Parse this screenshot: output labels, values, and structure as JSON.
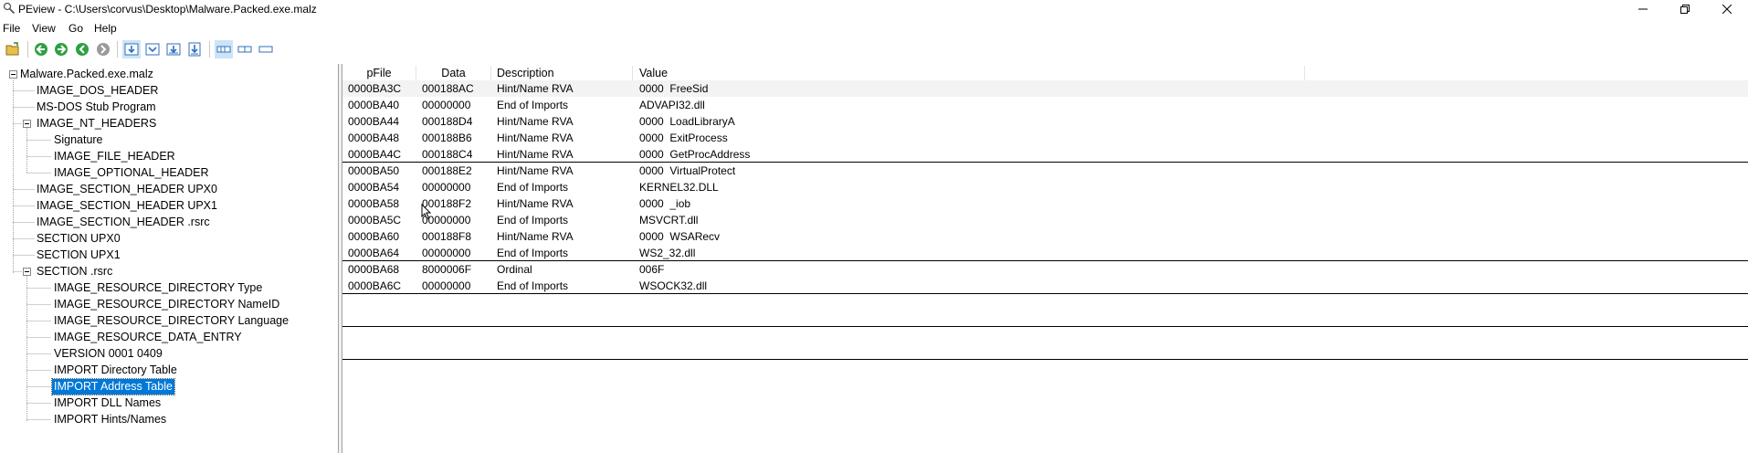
{
  "window": {
    "title": "PEview - C:\\Users\\corvus\\Desktop\\Malware.Packed.exe.malz"
  },
  "menu": [
    "File",
    "View",
    "Go",
    "Help"
  ],
  "toolbar": {
    "buttons": [
      "open-icon",
      "back-icon",
      "forward-icon",
      "previous-icon",
      "next-icon",
      "view-byte-icon",
      "view-word-icon",
      "view-dword-icon",
      "view-qword-icon",
      "hex-view-icon",
      "ascii-view-icon",
      "both-view-icon"
    ]
  },
  "tree": {
    "root": "Malware.Packed.exe.malz",
    "items": [
      {
        "label": "IMAGE_DOS_HEADER",
        "level": 1
      },
      {
        "label": "MS-DOS Stub Program",
        "level": 1
      },
      {
        "label": "IMAGE_NT_HEADERS",
        "level": 1
      },
      {
        "label": "Signature",
        "level": 2
      },
      {
        "label": "IMAGE_FILE_HEADER",
        "level": 2
      },
      {
        "label": "IMAGE_OPTIONAL_HEADER",
        "level": 2
      },
      {
        "label": "IMAGE_SECTION_HEADER UPX0",
        "level": 1
      },
      {
        "label": "IMAGE_SECTION_HEADER UPX1",
        "level": 1
      },
      {
        "label": "IMAGE_SECTION_HEADER .rsrc",
        "level": 1
      },
      {
        "label": "SECTION UPX0",
        "level": 1
      },
      {
        "label": "SECTION UPX1",
        "level": 1
      },
      {
        "label": "SECTION .rsrc",
        "level": 1
      },
      {
        "label": "IMAGE_RESOURCE_DIRECTORY Type",
        "level": 2
      },
      {
        "label": "IMAGE_RESOURCE_DIRECTORY NameID",
        "level": 2
      },
      {
        "label": "IMAGE_RESOURCE_DIRECTORY Language",
        "level": 2
      },
      {
        "label": "IMAGE_RESOURCE_DATA_ENTRY",
        "level": 2
      },
      {
        "label": "VERSION  0001  0409",
        "level": 2
      },
      {
        "label": "IMPORT Directory Table",
        "level": 2
      },
      {
        "label": "IMPORT Address Table",
        "level": 2,
        "selected": true
      },
      {
        "label": "IMPORT DLL Names",
        "level": 2
      },
      {
        "label": "IMPORT Hints/Names",
        "level": 2
      }
    ]
  },
  "table": {
    "columns": [
      "pFile",
      "Data",
      "Description",
      "Value"
    ],
    "rows": [
      {
        "pfile": "0000BA3C",
        "data": "000188AC",
        "desc": "Hint/Name RVA",
        "value": "0000  FreeSid"
      },
      {
        "pfile": "0000BA40",
        "data": "00000000",
        "desc": "End of Imports",
        "value": "ADVAPI32.dll"
      },
      {
        "pfile": "0000BA44",
        "data": "000188D4",
        "desc": "Hint/Name RVA",
        "value": "0000  LoadLibraryA"
      },
      {
        "pfile": "0000BA48",
        "data": "000188B6",
        "desc": "Hint/Name RVA",
        "value": "0000  ExitProcess"
      },
      {
        "pfile": "0000BA4C",
        "data": "000188C4",
        "desc": "Hint/Name RVA",
        "value": "0000  GetProcAddress"
      },
      {
        "pfile": "0000BA50",
        "data": "000188E2",
        "desc": "Hint/Name RVA",
        "value": "0000  VirtualProtect"
      },
      {
        "pfile": "0000BA54",
        "data": "00000000",
        "desc": "End of Imports",
        "value": "KERNEL32.DLL"
      },
      {
        "pfile": "0000BA58",
        "data": "000188F2",
        "desc": "Hint/Name RVA",
        "value": "0000  _iob"
      },
      {
        "pfile": "0000BA5C",
        "data": "00000000",
        "desc": "End of Imports",
        "value": "MSVCRT.dll"
      },
      {
        "pfile": "0000BA60",
        "data": "000188F8",
        "desc": "Hint/Name RVA",
        "value": "0000  WSARecv"
      },
      {
        "pfile": "0000BA64",
        "data": "00000000",
        "desc": "End of Imports",
        "value": "WS2_32.dll"
      },
      {
        "pfile": "0000BA68",
        "data": "8000006F",
        "desc": "Ordinal",
        "value": "006F"
      },
      {
        "pfile": "0000BA6C",
        "data": "00000000",
        "desc": "End of Imports",
        "value": "WSOCK32.dll"
      }
    ]
  },
  "colors": {
    "selection": "#0078d7",
    "toolbar_pressed": "#cce4f7",
    "row_alt": "#f3f3f3"
  }
}
